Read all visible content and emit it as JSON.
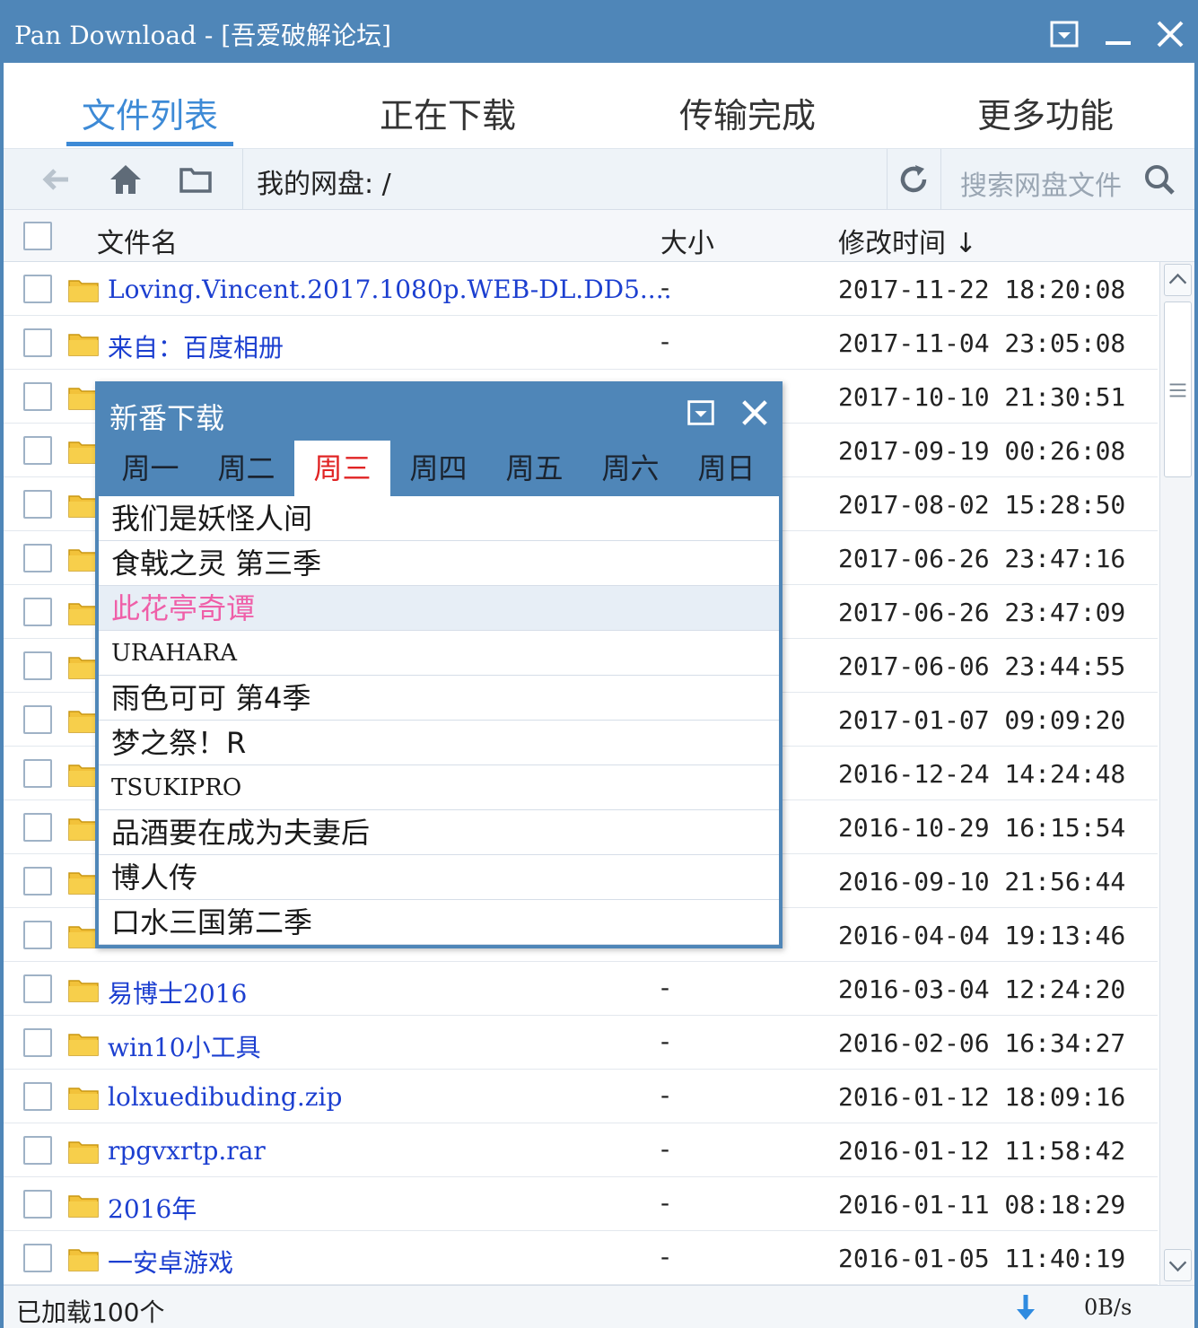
{
  "window": {
    "title": "Pan Download - [吾爱破解论坛]"
  },
  "tabs": [
    {
      "label": "文件列表",
      "active": true
    },
    {
      "label": "正在下载",
      "active": false
    },
    {
      "label": "传输完成",
      "active": false
    },
    {
      "label": "更多功能",
      "active": false
    }
  ],
  "toolbar": {
    "path": "我的网盘: /",
    "search_placeholder": "搜索网盘文件"
  },
  "table": {
    "headers": {
      "name": "文件名",
      "size": "大小",
      "modified": "修改时间 ↓"
    },
    "rows": [
      {
        "name": "Loving.Vincent.2017.1080p.WEB-DL.DD5....",
        "size": "-",
        "modified": "2017-11-22 18:20:08"
      },
      {
        "name": "来自：百度相册",
        "size": "-",
        "modified": "2017-11-04 23:05:08"
      },
      {
        "name": "",
        "size": "",
        "modified": "2017-10-10 21:30:51"
      },
      {
        "name": "",
        "size": "",
        "modified": "2017-09-19 00:26:08"
      },
      {
        "name": "",
        "size": "",
        "modified": "2017-08-02 15:28:50"
      },
      {
        "name": "",
        "size": "",
        "modified": "2017-06-26 23:47:16"
      },
      {
        "name": "",
        "size": "",
        "modified": "2017-06-26 23:47:09"
      },
      {
        "name": "",
        "size": "",
        "modified": "2017-06-06 23:44:55"
      },
      {
        "name": "",
        "size": "",
        "modified": "2017-01-07 09:09:20"
      },
      {
        "name": "",
        "size": "",
        "modified": "2016-12-24 14:24:48"
      },
      {
        "name": "",
        "size": "",
        "modified": "2016-10-29 16:15:54"
      },
      {
        "name": "",
        "size": "",
        "modified": "2016-09-10 21:56:44"
      },
      {
        "name": "",
        "size": "",
        "modified": "2016-04-04 19:13:46"
      },
      {
        "name": "易博士2016",
        "size": "-",
        "modified": "2016-03-04 12:24:20"
      },
      {
        "name": "win10小工具",
        "size": "-",
        "modified": "2016-02-06 16:34:27"
      },
      {
        "name": "lolxuedibuding.zip",
        "size": "-",
        "modified": "2016-01-12 18:09:16"
      },
      {
        "name": "rpgvxrtp.rar",
        "size": "-",
        "modified": "2016-01-12 11:58:42"
      },
      {
        "name": "2016年",
        "size": "-",
        "modified": "2016-01-11 08:18:29"
      },
      {
        "name": "一安卓游戏",
        "size": "-",
        "modified": "2016-01-05 11:40:19"
      }
    ]
  },
  "status": {
    "loaded": "已加载100个",
    "speed": "0B/s"
  },
  "popup": {
    "title": "新番下载",
    "days": [
      {
        "label": "周一",
        "active": false
      },
      {
        "label": "周二",
        "active": false
      },
      {
        "label": "周三",
        "active": true
      },
      {
        "label": "周四",
        "active": false
      },
      {
        "label": "周五",
        "active": false
      },
      {
        "label": "周六",
        "active": false
      },
      {
        "label": "周日",
        "active": false
      }
    ],
    "items": [
      {
        "label": "我们是妖怪人间",
        "highlight": false
      },
      {
        "label": "食戟之灵 第三季",
        "highlight": false
      },
      {
        "label": "此花亭奇谭",
        "highlight": true
      },
      {
        "label": "URAHARA",
        "highlight": false
      },
      {
        "label": "雨色可可 第4季",
        "highlight": false
      },
      {
        "label": "梦之祭！R",
        "highlight": false
      },
      {
        "label": "TSUKIPRO",
        "highlight": false
      },
      {
        "label": "品酒要在成为夫妻后",
        "highlight": false
      },
      {
        "label": "博人传",
        "highlight": false
      },
      {
        "label": "口水三国第二季",
        "highlight": false
      }
    ]
  },
  "colors": {
    "titlebar": "#4f86b8",
    "accent": "#3d8ad6",
    "link": "#1c3fd0",
    "active_day": "#e02424",
    "highlight_item": "#ef5fa8"
  },
  "icons": [
    "back-arrow-icon",
    "home-icon",
    "new-folder-icon",
    "refresh-icon",
    "search-icon",
    "folder-icon",
    "download-arrow-icon",
    "restore-icon",
    "minimize-icon",
    "close-icon"
  ]
}
